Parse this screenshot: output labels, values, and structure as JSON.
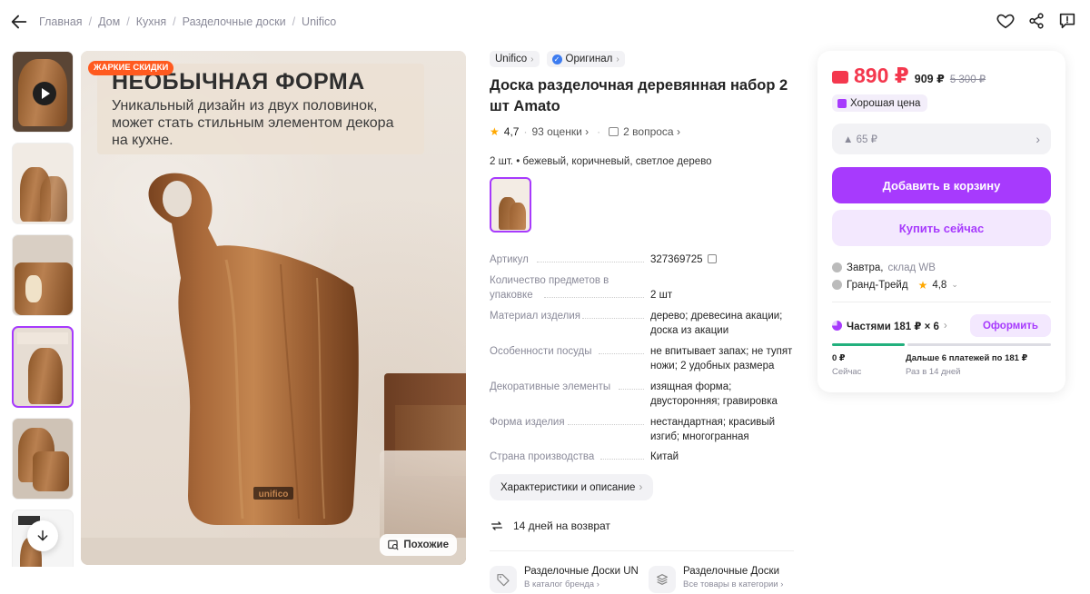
{
  "breadcrumb": [
    "Главная",
    "Дом",
    "Кухня",
    "Разделочные доски",
    "Unifico"
  ],
  "product": {
    "brand": "Unifico",
    "original": "Оригинал",
    "title": "Доска разделочная деревянная набор 2 шт Amato",
    "rating": "4,7",
    "reviews": "93 оценки",
    "questions": "2 вопроса",
    "variant_label": "2 шт. • бежевый, коричневый, светлое дерево"
  },
  "image": {
    "hot_badge": "ЖАРКИЕ СКИДКИ",
    "banner_title": "НЕОБЫЧНАЯ ФОРМА",
    "banner_text": "Уникальный дизайн из двух половинок, может стать стильным элементом декора на кухне.",
    "board_logo": "unifico",
    "similar": "Похожие"
  },
  "specs": [
    {
      "key": "Артикул",
      "value": "327369725"
    },
    {
      "key": "Количество предметов в упаковке",
      "value": "2 шт"
    },
    {
      "key": "Материал изделия",
      "value": "дерево; древесина акации; доска из акации"
    },
    {
      "key": "Особенности посуды",
      "value": "не впитывает запах; не тупят ножи; 2 удобных размера"
    },
    {
      "key": "Декоративные элементы",
      "value": "изящная форма; двусторонняя; гравировка"
    },
    {
      "key": "Форма изделия",
      "value": "нестандартная; красивый изгиб; многогранная"
    },
    {
      "key": "Страна производства",
      "value": "Китай"
    }
  ],
  "characteristics_button": "Характеристики и описание",
  "return_policy": "14 дней на возврат",
  "brand_links": [
    {
      "title": "Разделочные Доски UNIFICO",
      "subtitle": "В каталог бренда"
    },
    {
      "title": "Разделочные Доски",
      "subtitle": "Все товары в категории"
    }
  ],
  "buy_card": {
    "price": "890 ₽",
    "price_wallet_off": "909 ₽",
    "price_old": "5 300 ₽",
    "good_price": "Хорошая цена",
    "bonus": "▲ 65 ₽",
    "add_to_cart": "Добавить в корзину",
    "buy_now": "Купить сейчас",
    "delivery_day": "Завтра,",
    "delivery_wh": "склад WB",
    "seller": "Гранд-Трейд",
    "seller_rating": "4,8",
    "split_label": "Частями 181 ₽ × 6",
    "split_button": "Оформить",
    "plan_now_amount": "0 ₽",
    "plan_now_label": "Сейчас",
    "plan_later_amount": "Дальше 6 платежей по 181 ₽",
    "plan_later_label": "Раз в 14 дней",
    "first_payment_progress": 0.33
  },
  "colors": {
    "accent": "#a73afd",
    "price": "#f4384e",
    "accent_light": "#f3e8fe",
    "progress": "#22b07d"
  }
}
